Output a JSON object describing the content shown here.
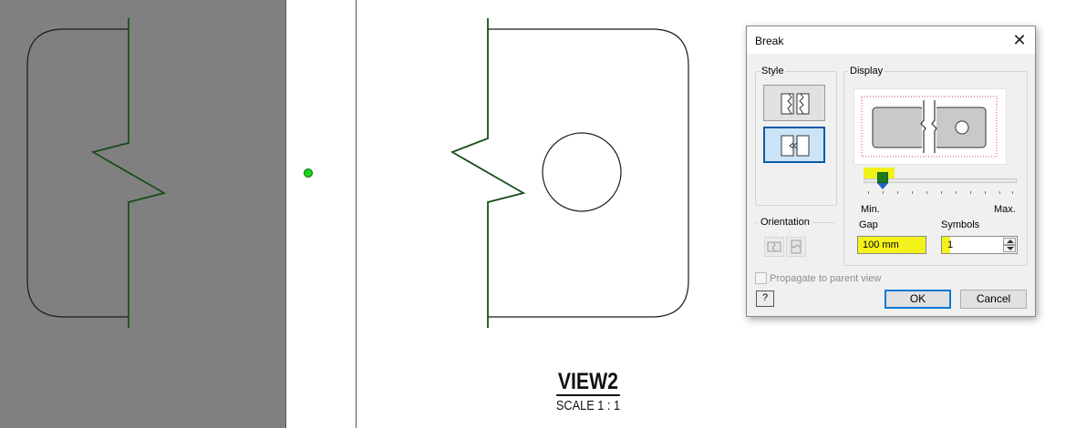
{
  "drawing": {
    "view_title": "VIEW2",
    "view_scale": "SCALE 1 : 1"
  },
  "dialog": {
    "title": "Break",
    "close_glyph": "✕",
    "style_group_label": "Style",
    "display_group_label": "Display",
    "orientation_group_label": "Orientation",
    "slider_min_label": "Min.",
    "slider_max_label": "Max.",
    "gap_label": "Gap",
    "gap_value": "100 mm",
    "symbols_label": "Symbols",
    "symbols_value": "1",
    "propagate_label": "Propagate to parent view",
    "help_glyph": "?",
    "ok_label": "OK",
    "cancel_label": "Cancel"
  },
  "colors": {
    "break_line": "#1a4d1a",
    "highlight": "#f3f31b",
    "slider_thumb_top": "#1f7a1f",
    "slider_thumb_bottom": "#1f63c6",
    "selected_style_bg": "#cce4f7"
  },
  "icons": {
    "style_rectangular": "rectangular-break-style-icon",
    "style_structural": "structural-break-style-icon",
    "orientation_horizontal": "horizontal-orientation-icon",
    "orientation_vertical": "vertical-orientation-icon",
    "close": "close-icon",
    "help": "help-icon"
  }
}
